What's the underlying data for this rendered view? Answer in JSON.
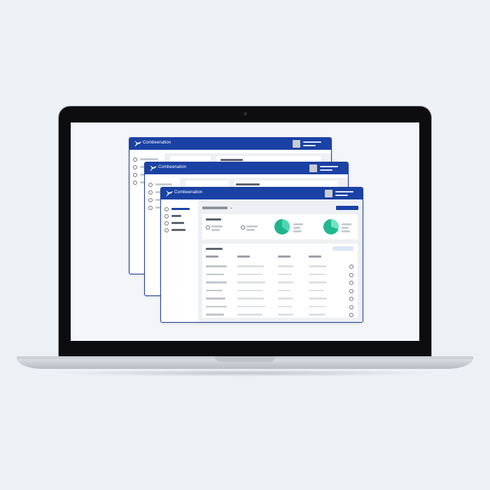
{
  "app": {
    "brand_name": "Combeenation",
    "brand_color": "#1a42a5",
    "accent_color": "#2ec4a0",
    "icons": {
      "logo": "combeenation-logo-icon",
      "avatar": "user-avatar-icon",
      "radio": "radio-circle-icon",
      "dropdown": "chevron-down-icon"
    }
  },
  "windows": [
    {
      "id": "back",
      "title": "Combeenation"
    },
    {
      "id": "middle",
      "title": "Combeenation"
    },
    {
      "id": "front",
      "title": "Combeenation"
    }
  ]
}
